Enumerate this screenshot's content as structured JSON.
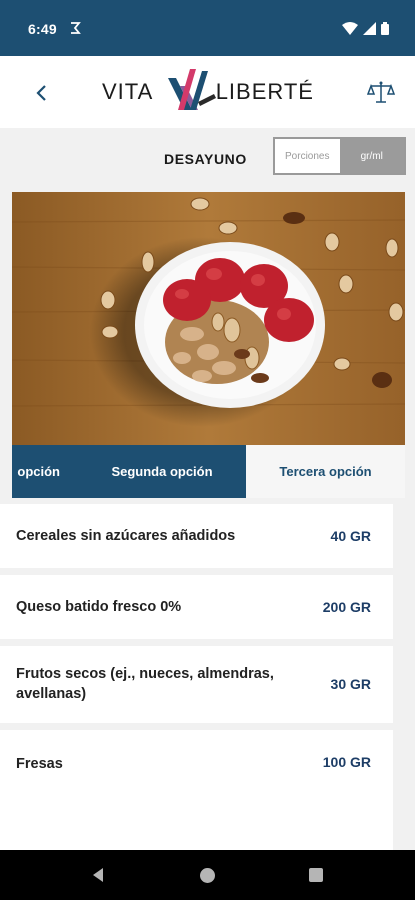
{
  "status_bar": {
    "time": "6:49"
  },
  "header": {
    "logo_left": "VITA",
    "logo_right": "LIBERTÉ",
    "back_icon": "chevron-left-icon",
    "scale_icon": "scale-icon"
  },
  "meal": {
    "title": "DESAYUNO",
    "unit_toggle": {
      "option_a": "Porciones",
      "option_b": "gr/ml",
      "selected": "gr/ml"
    }
  },
  "tabs": [
    {
      "label": "opción"
    },
    {
      "label": "Segunda opción"
    },
    {
      "label": "Tercera opción"
    }
  ],
  "foods": [
    {
      "name": "Cereales sin azúcares añadidos",
      "qty": "40 GR"
    },
    {
      "name": "Queso batido fresco 0%",
      "qty": "200 GR"
    },
    {
      "name": "Frutos secos (ej., nueces, almendras, avellanas)",
      "qty": "30 GR"
    },
    {
      "name": "Fresas",
      "qty": "100 GR"
    }
  ],
  "colors": {
    "primary": "#1d4f72",
    "qty_text": "#1d3d66"
  }
}
